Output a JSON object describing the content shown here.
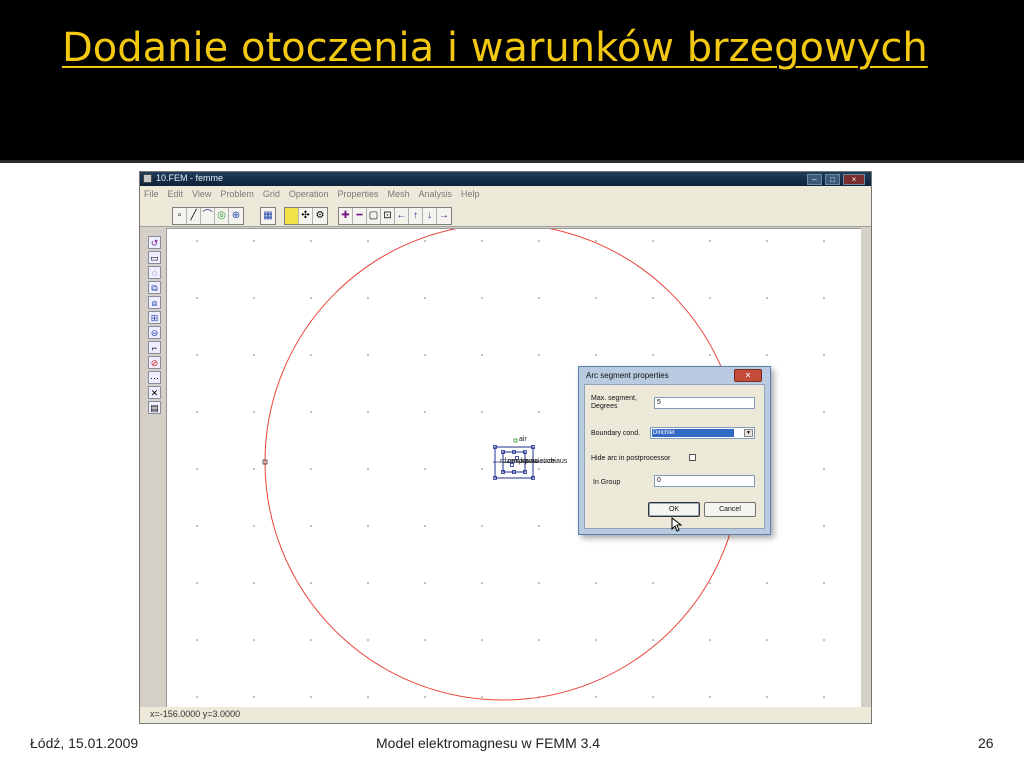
{
  "slide": {
    "title": "Dodanie otoczenia i warunków brzegowych",
    "footer_left": "Łódź, 15.01.2009",
    "footer_center": "Model elektromagnesu w FEMM 3.4",
    "page_number": "26"
  },
  "app": {
    "window_title": "10.FEM - femme",
    "menu": [
      "File",
      "Edit",
      "View",
      "Problem",
      "Grid",
      "Operation",
      "Properties",
      "Mesh",
      "Analysis",
      "Help"
    ],
    "status": "x=-156.0000 y=3.0000"
  },
  "canvas": {
    "labels": [
      "air",
      "rdzen",
      "cewka",
      "prawa",
      "powietrze",
      "chiaus"
    ]
  },
  "dialog": {
    "title": "Arc segment properties",
    "max_segment_label_1": "Max. segment,",
    "max_segment_label_2": "Degrees",
    "max_segment_value": "5",
    "boundary_label": "Boundary cond.",
    "boundary_value": "Dirichlet",
    "hide_arc_label": "Hide arc in postprocessor",
    "group_label": "In Group",
    "group_value": "0",
    "ok": "OK",
    "cancel": "Cancel"
  },
  "colors": {
    "title_yellow": "#f2c811",
    "arc_red": "#e8443a",
    "selection_blue": "#1e2f8c"
  }
}
